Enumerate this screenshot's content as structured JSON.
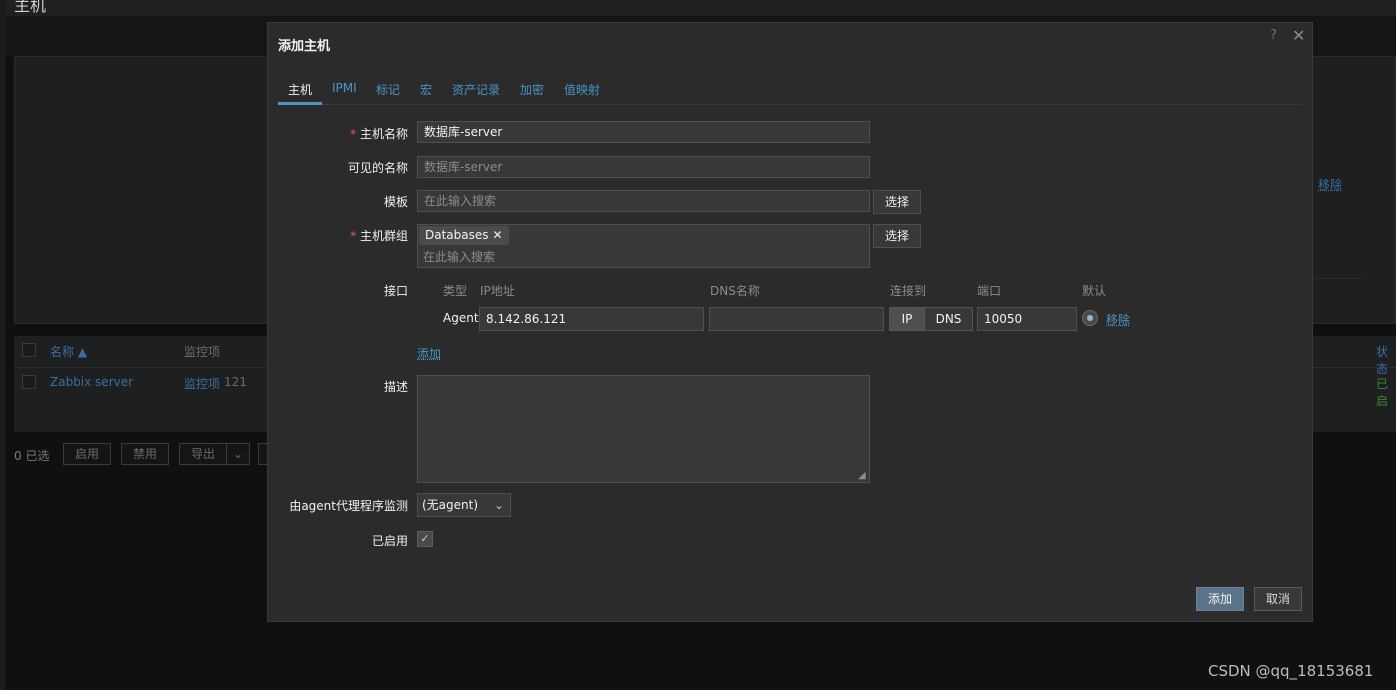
{
  "background": {
    "page_title": "主机",
    "remove_link": "移除",
    "table": {
      "columns": {
        "name": "名称 ▲",
        "items": "监控项",
        "status": "状态"
      },
      "row": {
        "name": "Zabbix server",
        "items_link": "监控项",
        "items_count": "121",
        "status": "已启"
      }
    },
    "footer": {
      "selected": "0 已选",
      "enable": "启用",
      "disable": "禁用",
      "export": "导出"
    }
  },
  "modal": {
    "title": "添加主机",
    "help": "?",
    "close": "✕",
    "tabs": [
      "主机",
      "IPMI",
      "标记",
      "宏",
      "资产记录",
      "加密",
      "值映射"
    ],
    "active_tab": "主机",
    "form": {
      "host_name": {
        "label": "主机名称",
        "value": "数据库-server"
      },
      "visible_name": {
        "label": "可见的名称",
        "placeholder": "数据库-server"
      },
      "templates": {
        "label": "模板",
        "placeholder": "在此输入搜索",
        "select": "选择"
      },
      "groups": {
        "label": "主机群组",
        "tag": "Databases",
        "placeholder": "在此输入搜索",
        "select": "选择"
      },
      "interfaces": {
        "label": "接口",
        "headers": {
          "type": "类型",
          "ip": "IP地址",
          "dns": "DNS名称",
          "connect": "连接到",
          "port": "端口",
          "default": "默认"
        },
        "row": {
          "type": "Agent",
          "ip": "8.142.86.121",
          "dns": "",
          "connect_ip": "IP",
          "connect_dns": "DNS",
          "port": "10050",
          "remove": "移除"
        },
        "add": "添加"
      },
      "description": {
        "label": "描述"
      },
      "proxy": {
        "label": "由agent代理程序监测",
        "value": "(无agent)"
      },
      "enabled": {
        "label": "已启用",
        "checked": true
      }
    },
    "buttons": {
      "add": "添加",
      "cancel": "取消"
    }
  },
  "watermark": "CSDN @qq_18153681",
  "colors": {
    "accent": "#4796c4",
    "modal_bg": "#2b2b2b",
    "primary_button": "#5a7389",
    "required": "#e45959"
  }
}
